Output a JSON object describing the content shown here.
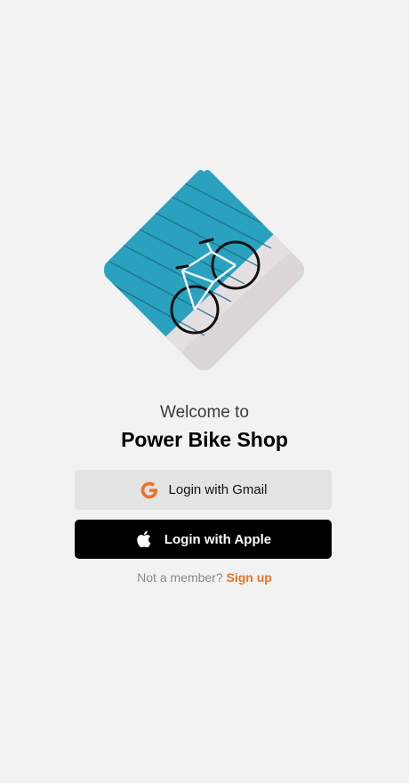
{
  "welcome": {
    "line1": "Welcome to",
    "shop_name": "Power Bike Shop"
  },
  "hero": {
    "image": "bicycle-against-blue-wall"
  },
  "buttons": {
    "gmail": {
      "label": "Login with Gmail",
      "icon": "google-icon",
      "icon_color": "#e8742a"
    },
    "apple": {
      "label": "Login with Apple",
      "icon": "apple-icon"
    }
  },
  "footer": {
    "prompt": "Not a member?",
    "link": "Sign up"
  },
  "colors": {
    "accent": "#e8742a",
    "background": "#f2f2f2",
    "apple_button": "#000000",
    "gmail_button": "#e3e3e3"
  }
}
